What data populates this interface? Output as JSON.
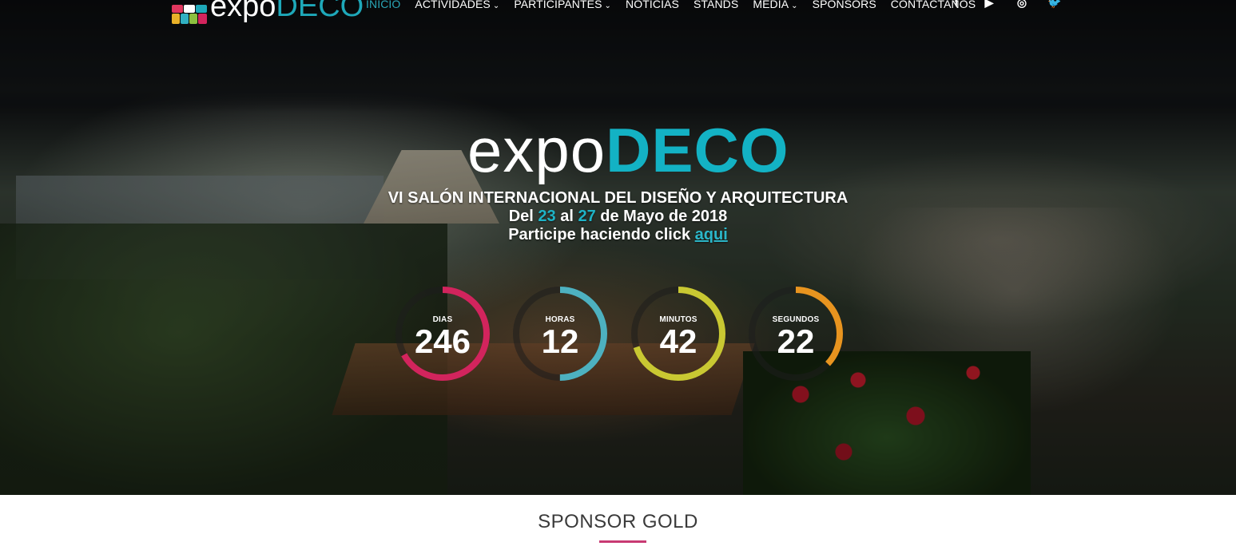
{
  "nav": {
    "logo_text_a": "expo",
    "logo_text_b": "DECO",
    "items": [
      {
        "label": "INICIO",
        "has_dropdown": false,
        "active": true
      },
      {
        "label": "ACTIVIDADES",
        "has_dropdown": true,
        "active": false
      },
      {
        "label": "PARTICIPANTES",
        "has_dropdown": true,
        "active": false
      },
      {
        "label": "NOTICIAS",
        "has_dropdown": false,
        "active": false
      },
      {
        "label": "STANDS",
        "has_dropdown": false,
        "active": false
      },
      {
        "label": "MEDIA",
        "has_dropdown": true,
        "active": false
      },
      {
        "label": "SPONSORS",
        "has_dropdown": false,
        "active": false
      },
      {
        "label": "CONTACTANOS",
        "has_dropdown": false,
        "active": false
      }
    ],
    "social": [
      {
        "icon": "facebook-icon",
        "glyph": "f"
      },
      {
        "icon": "youtube-icon",
        "glyph": "▶"
      },
      {
        "icon": "instagram-icon",
        "glyph": "◎"
      },
      {
        "icon": "twitter-icon",
        "glyph": "🐦"
      }
    ],
    "active_color": "#2aa6b6"
  },
  "hero": {
    "logo_a": "expo",
    "logo_b": "DECO",
    "logo_b_color": "#13b2c4",
    "line1": "VI SALÓN INTERNACIONAL DEL DISEÑO Y ARQUITECTURA",
    "line2_pre": "Del ",
    "line2_day1": "23",
    "line2_mid": " al ",
    "line2_day2": "27",
    "line2_post": " de Mayo de 2018",
    "line3_pre": "Participe haciendo click ",
    "line3_link": "aqui"
  },
  "countdown": [
    {
      "label": "DIAS",
      "value": "246",
      "color": "#d2245d",
      "fraction": 0.67
    },
    {
      "label": "HORAS",
      "value": "12",
      "color": "#4db1c0",
      "fraction": 0.5
    },
    {
      "label": "MINUTOS",
      "value": "42",
      "color": "#c9c832",
      "fraction": 0.7
    },
    {
      "label": "SEGUNDOS",
      "value": "22",
      "color": "#e8941f",
      "fraction": 0.37
    }
  ],
  "sponsor": {
    "title": "SPONSOR GOLD",
    "accent": "#c83a73"
  }
}
